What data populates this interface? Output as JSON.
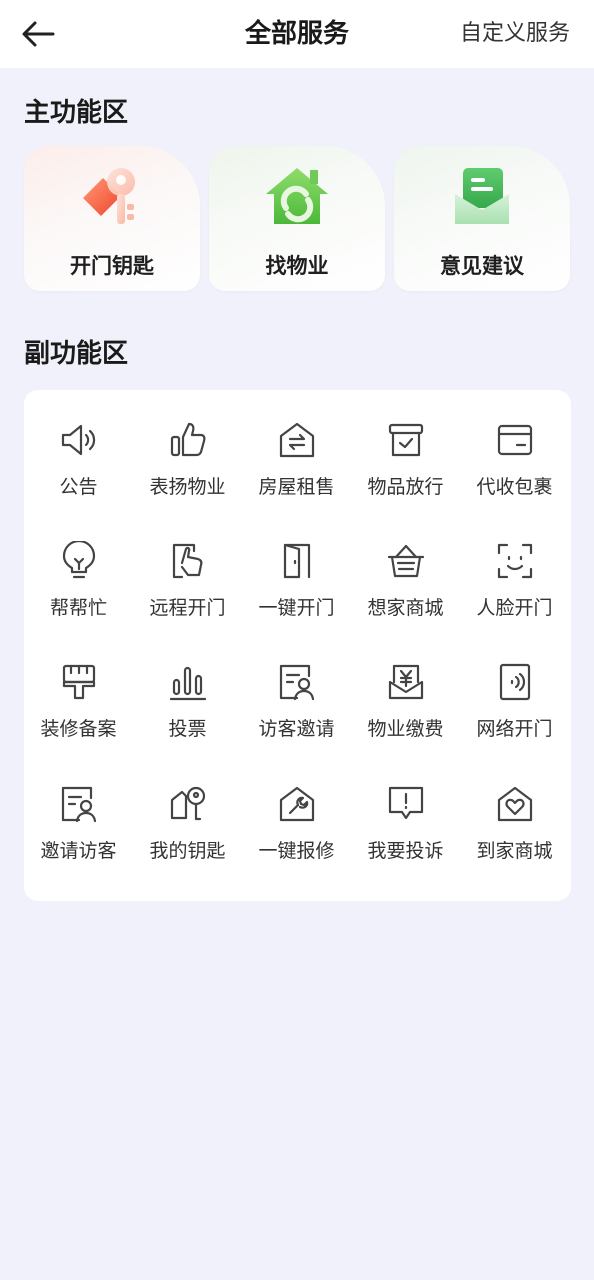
{
  "header": {
    "title": "全部服务",
    "custom_label": "自定义服务"
  },
  "main_section": {
    "title": "主功能区",
    "items": [
      {
        "label": "开门钥匙",
        "icon": "key-icon"
      },
      {
        "label": "找物业",
        "icon": "property-house-icon"
      },
      {
        "label": "意见建议",
        "icon": "feedback-envelope-icon"
      }
    ]
  },
  "sub_section": {
    "title": "副功能区",
    "items": [
      {
        "label": "公告",
        "icon": "speaker-icon"
      },
      {
        "label": "表扬物业",
        "icon": "thumbs-up-icon"
      },
      {
        "label": "房屋租售",
        "icon": "house-exchange-icon"
      },
      {
        "label": "物品放行",
        "icon": "package-box-icon"
      },
      {
        "label": "代收包裹",
        "icon": "parcel-icon"
      },
      {
        "label": "帮帮忙",
        "icon": "lightbulb-icon"
      },
      {
        "label": "远程开门",
        "icon": "remote-tap-icon"
      },
      {
        "label": "一键开门",
        "icon": "door-icon"
      },
      {
        "label": "想家商城",
        "icon": "basket-icon"
      },
      {
        "label": "人脸开门",
        "icon": "face-scan-icon"
      },
      {
        "label": "装修备案",
        "icon": "paint-brush-icon"
      },
      {
        "label": "投票",
        "icon": "bar-chart-icon"
      },
      {
        "label": "访客邀请",
        "icon": "visitor-card-icon"
      },
      {
        "label": "物业缴费",
        "icon": "yen-payment-icon"
      },
      {
        "label": "网络开门",
        "icon": "nfc-door-icon"
      },
      {
        "label": "邀请访客",
        "icon": "invite-visitor-icon"
      },
      {
        "label": "我的钥匙",
        "icon": "my-keys-icon"
      },
      {
        "label": "一键报修",
        "icon": "wrench-house-icon"
      },
      {
        "label": "我要投诉",
        "icon": "complaint-icon"
      },
      {
        "label": "到家商城",
        "icon": "heart-house-icon"
      }
    ]
  }
}
